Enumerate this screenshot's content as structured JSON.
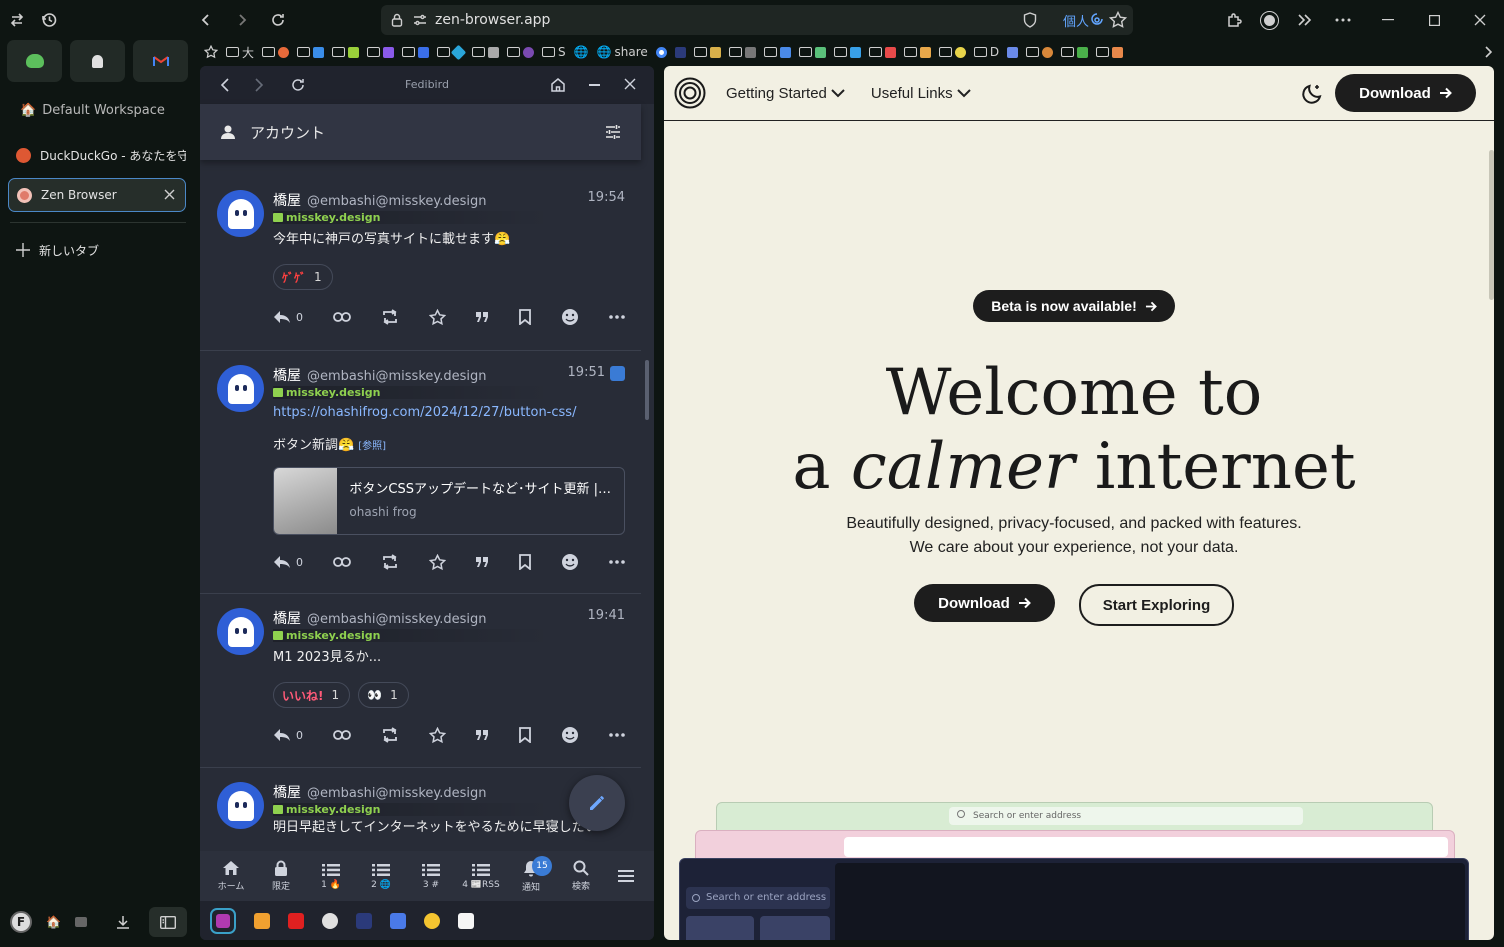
{
  "browser": {
    "url": "zen-browser.app",
    "private_label": "個人",
    "bookmarks": [
      "大",
      "S",
      "share",
      "D"
    ]
  },
  "sidebar": {
    "workspace_name": "Default Workspace",
    "tabs": [
      {
        "label": "DuckDuckGo - あなたを守る",
        "color": "#de5833"
      },
      {
        "label": "Zen Browser",
        "color": "#e07b6a"
      }
    ],
    "new_tab_label": "新しいタブ"
  },
  "fedibird": {
    "title": "Fedibird",
    "account_label": "アカウント",
    "posts": [
      {
        "name": "橋屋",
        "handle": "@embashi@misskey.design",
        "time": "19:54",
        "instance": "misskey.design",
        "text": "今年中に神戸の写真サイトに載せます😤",
        "reactions": [
          {
            "emoji": "ｹﾞｹﾞ",
            "count": "1"
          }
        ],
        "reply_count": "0"
      },
      {
        "name": "橋屋",
        "handle": "@embashi@misskey.design",
        "time": "19:51",
        "instance": "misskey.design",
        "link": "https://ohashifrog.com/2024/12/27/button-css/",
        "text": "ボタン新調😤",
        "ref_label": "[参照]",
        "card": {
          "title": "ボタンCSSアップデートなど･サイト更新 | ohash...",
          "site": "ohashi frog"
        },
        "reply_count": "0"
      },
      {
        "name": "橋屋",
        "handle": "@embashi@misskey.design",
        "time": "19:41",
        "instance": "misskey.design",
        "text": "M1 2023見るか...",
        "reactions": [
          {
            "emoji": "いいね!",
            "count": "1"
          },
          {
            "emoji": "👀",
            "count": "1"
          }
        ],
        "reply_count": "0"
      },
      {
        "name": "橋屋",
        "handle": "@embashi@misskey.design",
        "time": "",
        "instance": "misskey.design",
        "text": "明日早起きしてインターネットをやるために早寝したい"
      }
    ],
    "nav": [
      {
        "label": "ホーム",
        "icon": "home-icon"
      },
      {
        "label": "限定",
        "icon": "lock-icon"
      },
      {
        "label": "1 🔥",
        "icon": "list-icon"
      },
      {
        "label": "2 🌐",
        "icon": "list-icon"
      },
      {
        "label": "3 #",
        "icon": "list-icon"
      },
      {
        "label": "4 📰RSS",
        "icon": "list-icon"
      },
      {
        "label": "通知",
        "icon": "bell-icon",
        "badge": "15"
      },
      {
        "label": "検索",
        "icon": "search-icon"
      }
    ]
  },
  "site": {
    "nav": {
      "getting_started": "Getting Started",
      "useful_links": "Useful Links",
      "download": "Download"
    },
    "beta_pill": "Beta is now available!",
    "hero_line1": "Welcome to",
    "hero_line2_a": "a ",
    "hero_line2_em": "calmer",
    "hero_line2_b": " internet",
    "tagline1": "Beautifully designed, privacy-focused, and packed with features.",
    "tagline2": "We care about your experience, not your data.",
    "cta_download": "Download",
    "cta_explore": "Start Exploring",
    "preview_search": "Search or enter address"
  }
}
